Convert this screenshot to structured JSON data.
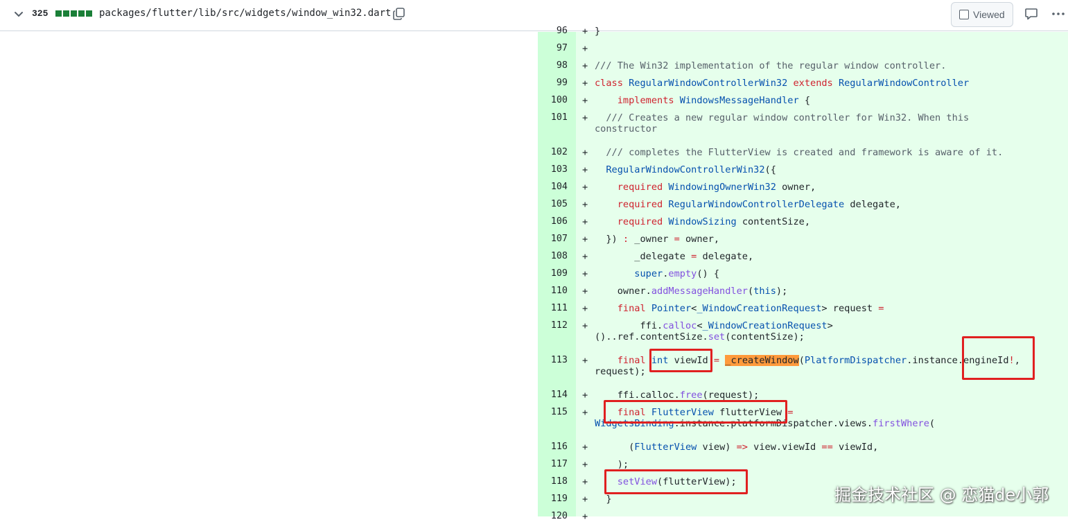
{
  "file_header": {
    "change_count": "325",
    "diff_block_colors": [
      "#1a7f37",
      "#1a7f37",
      "#1a7f37",
      "#1a7f37",
      "#1a7f37"
    ],
    "file_path": "packages/flutter/lib/src/widgets/window_win32.dart",
    "viewed_label": "Viewed",
    "icons": [
      "chevron-down-icon",
      "copy-icon",
      "comment-icon",
      "kebab-horizontal-icon"
    ]
  },
  "diff": {
    "added_gutter_color": "#ccffd8",
    "added_line_color": "#e6ffec",
    "marker": "+",
    "lines": [
      {
        "num": "96",
        "text": "}"
      },
      {
        "num": "97",
        "text": ""
      },
      {
        "num": "98",
        "text": "/// The Win32 implementation of the regular window controller."
      },
      {
        "num": "99",
        "text": "class RegularWindowControllerWin32 extends RegularWindowController"
      },
      {
        "num": "100",
        "text": "    implements WindowsMessageHandler {"
      },
      {
        "num": "101",
        "text": "  /// Creates a new regular window controller for Win32. When this constructor"
      },
      {
        "num": "102",
        "text": "  /// completes the FlutterView is created and framework is aware of it."
      },
      {
        "num": "103",
        "text": "  RegularWindowControllerWin32({"
      },
      {
        "num": "104",
        "text": "    required WindowingOwnerWin32 owner,"
      },
      {
        "num": "105",
        "text": "    required RegularWindowControllerDelegate delegate,"
      },
      {
        "num": "106",
        "text": "    required WindowSizing contentSize,"
      },
      {
        "num": "107",
        "text": "  }) : _owner = owner,"
      },
      {
        "num": "108",
        "text": "       _delegate = delegate,"
      },
      {
        "num": "109",
        "text": "       super.empty() {"
      },
      {
        "num": "110",
        "text": "    owner.addMessageHandler(this);"
      },
      {
        "num": "111",
        "text": "    final Pointer<_WindowCreationRequest> request ="
      },
      {
        "num": "112",
        "text": "        ffi.calloc<_WindowCreationRequest>()..ref.contentSize.set(contentSize);"
      },
      {
        "num": "113",
        "text": "    final int viewId = _createWindow(PlatformDispatcher.instance.engineId!, request);"
      },
      {
        "num": "114",
        "text": "    ffi.calloc.free(request);"
      },
      {
        "num": "115",
        "text": "    final FlutterView flutterView = WidgetsBinding.instance.platformDispatcher.views.firstWhere("
      },
      {
        "num": "116",
        "text": "      (FlutterView view) => view.viewId == viewId,"
      },
      {
        "num": "117",
        "text": "    );"
      },
      {
        "num": "118",
        "text": "    setView(flutterView);"
      },
      {
        "num": "119",
        "text": "  }"
      },
      {
        "num": "120",
        "text": ""
      }
    ],
    "highlighted_token": "_createWindow",
    "highlight_color": "#ff9a3c",
    "annotation_box_color": "#e02020"
  },
  "watermark": "掘金技术社区 @ 恋猫de小郭"
}
